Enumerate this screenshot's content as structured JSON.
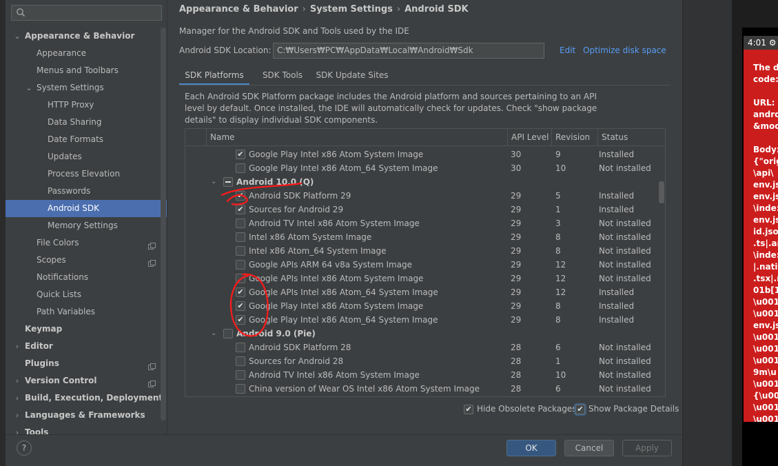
{
  "sidebar": {
    "search_placeholder": "",
    "items": [
      {
        "label": "Appearance & Behavior",
        "level": 0,
        "arrow": "down",
        "bold": true
      },
      {
        "label": "Appearance",
        "level": 1
      },
      {
        "label": "Menus and Toolbars",
        "level": 1
      },
      {
        "label": "System Settings",
        "level": 1,
        "arrow": "down"
      },
      {
        "label": "HTTP Proxy",
        "level": 2
      },
      {
        "label": "Data Sharing",
        "level": 2
      },
      {
        "label": "Date Formats",
        "level": 2
      },
      {
        "label": "Updates",
        "level": 2
      },
      {
        "label": "Process Elevation",
        "level": 2
      },
      {
        "label": "Passwords",
        "level": 2
      },
      {
        "label": "Android SDK",
        "level": 2,
        "selected": true
      },
      {
        "label": "Memory Settings",
        "level": 2
      },
      {
        "label": "File Colors",
        "level": 1,
        "copy": true
      },
      {
        "label": "Scopes",
        "level": 1,
        "copy": true
      },
      {
        "label": "Notifications",
        "level": 1
      },
      {
        "label": "Quick Lists",
        "level": 1
      },
      {
        "label": "Path Variables",
        "level": 1
      },
      {
        "label": "Keymap",
        "level": 0,
        "bold": true
      },
      {
        "label": "Editor",
        "level": 0,
        "arrow": "right",
        "bold": true
      },
      {
        "label": "Plugins",
        "level": 0,
        "bold": true,
        "copy": true
      },
      {
        "label": "Version Control",
        "level": 0,
        "arrow": "right",
        "bold": true,
        "copy": true
      },
      {
        "label": "Build, Execution, Deployment",
        "level": 0,
        "arrow": "right",
        "bold": true
      },
      {
        "label": "Languages & Frameworks",
        "level": 0,
        "arrow": "right",
        "bold": true
      },
      {
        "label": "Tools",
        "level": 0,
        "arrow": "right",
        "bold": true
      }
    ]
  },
  "breadcrumb": [
    "Appearance & Behavior",
    "System Settings",
    "Android SDK"
  ],
  "description": "Manager for the Android SDK and Tools used by the IDE",
  "sdk_location": {
    "label": "Android SDK Location:",
    "value": "C:₩Users₩PC₩AppData₩Local₩Android₩Sdk",
    "edit": "Edit",
    "optimize": "Optimize disk space"
  },
  "tabs": [
    "SDK Platforms",
    "SDK Tools",
    "SDK Update Sites"
  ],
  "info_text": "Each Android SDK Platform package includes the Android platform and sources pertaining to an API level by default. Once installed, the IDE will automatically check for updates. Check \"show package details\" to display individual SDK components.",
  "table": {
    "columns": [
      "Name",
      "API Level",
      "Revision",
      "Status"
    ],
    "rows": [
      {
        "name": "Google Play Intel x86 Atom System Image",
        "api": "30",
        "rev": "9",
        "status": "Installed",
        "checked": true
      },
      {
        "name": "Google Play Intel x86 Atom_64 System Image",
        "api": "30",
        "rev": "10",
        "status": "Not installed",
        "checked": false
      },
      {
        "name": "Android 10.0 (Q)",
        "group": true,
        "state": "partial"
      },
      {
        "name": "Android SDK Platform 29",
        "api": "29",
        "rev": "5",
        "status": "Installed",
        "checked": true
      },
      {
        "name": "Sources for Android 29",
        "api": "29",
        "rev": "1",
        "status": "Installed",
        "checked": true
      },
      {
        "name": "Android TV Intel x86 Atom System Image",
        "api": "29",
        "rev": "3",
        "status": "Not installed",
        "checked": false
      },
      {
        "name": "Intel x86 Atom System Image",
        "api": "29",
        "rev": "8",
        "status": "Not installed",
        "checked": false
      },
      {
        "name": "Intel x86 Atom_64 System Image",
        "api": "29",
        "rev": "8",
        "status": "Not installed",
        "checked": false
      },
      {
        "name": "Google APIs ARM 64 v8a System Image",
        "api": "29",
        "rev": "12",
        "status": "Not installed",
        "checked": false
      },
      {
        "name": "Google APIs Intel x86 Atom System Image",
        "api": "29",
        "rev": "12",
        "status": "Not installed",
        "checked": false
      },
      {
        "name": "Google APIs Intel x86 Atom_64 System Image",
        "api": "29",
        "rev": "12",
        "status": "Installed",
        "checked": true
      },
      {
        "name": "Google Play Intel x86 Atom System Image",
        "api": "29",
        "rev": "8",
        "status": "Installed",
        "checked": true
      },
      {
        "name": "Google Play Intel x86 Atom_64 System Image",
        "api": "29",
        "rev": "8",
        "status": "Installed",
        "checked": true
      },
      {
        "name": "Android 9.0 (Pie)",
        "group": true,
        "state": "unchecked"
      },
      {
        "name": "Android SDK Platform 28",
        "api": "28",
        "rev": "6",
        "status": "Not installed",
        "checked": false
      },
      {
        "name": "Sources for Android 28",
        "api": "28",
        "rev": "1",
        "status": "Not installed",
        "checked": false
      },
      {
        "name": "Android TV Intel x86 Atom System Image",
        "api": "28",
        "rev": "10",
        "status": "Not installed",
        "checked": false
      },
      {
        "name": "China version of Wear OS Intel x86 Atom System Image",
        "api": "28",
        "rev": "6",
        "status": "Not installed",
        "checked": false
      }
    ]
  },
  "options": {
    "hide_obsolete": "Hide Obsolete Packages",
    "show_details": "Show Package Details"
  },
  "buttons": {
    "help": "?",
    "ok": "OK",
    "cancel": "Cancel",
    "apply": "Apply"
  },
  "emulator": {
    "time": "4:01",
    "error_text": "The d\ncode:\n\nURL: \nandro\n&mod\n\nBody:\n{\"origi\n\\api\\\nenv.js\nenv.js\n\\inde:\nenv.js\nid.jso\n.ts|.an\n\\inde:\n|.nativ\n.tsx|.n\n01b[1\n\\u001\n\\u001\nenv.js\n\\u001\n\\u001\n\\u001\n9m\\u\n\\u001\n{\\u00\n\\u001\n\\u001"
  },
  "colors": {
    "selection": "#4b6eaf",
    "link": "#589df6",
    "annotation": "#ff1a1a",
    "error_bg": "#cc1d1d"
  }
}
